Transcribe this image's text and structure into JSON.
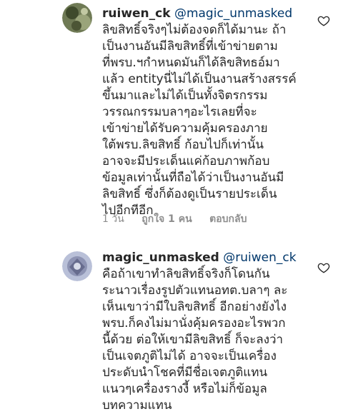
{
  "comments": [
    {
      "username": "ruiwen_ck",
      "mention": "@magic_unmasked",
      "lines": [
        "ลิขสิทธิ์จริงๆไม่ต้องจดก็ได้มานะ ถ้า",
        "เป็นงานอันมีลิขสิทธิ์ที่เข้าข่ายตาม",
        "ที่พรบ.ฯกำหนดมันก็ได้ลิขสิทธอ์มา",
        "แล้ว entityนี่ไม่ได้เป็นงานสร้างสรรค์",
        "ขึ้นมาและไม่ได้เป็นทั้งจิตรกรรม",
        "วรรณกรรมบลาๆอะไรเลยที่จะ",
        "เข้าข่ายได้รับความคุ้มครองภาย",
        "ใต้พรบ.ลิขสิทธิ์ ก้อบไปก็เท่านั้น",
        "อาจจะมีประเด็นแค่ก้อบภาพก้อบ",
        "ข้อมูลเท่านั้นที่ถือได้ว่าเป็นงานอันมี",
        "ลิขสิทธิ์ ซึ่งก็ต้องดูเป็นรายประเด็น",
        "ไปอีกทีอีก"
      ],
      "time": "1 วัน",
      "likes": "ถูกใจ 1 คน",
      "reply": "ตอบกลับ",
      "heart_icon": "heart-outline-icon"
    },
    {
      "username": "magic_unmasked",
      "mention": "@ruiwen_ck",
      "lines": [
        "คือถ้าเขาทำลิขสิทธิ์จริงก็โดนกัน",
        "ระนาวเรื่องรูปตัวแทนอทต.บลาๆ ละ",
        "เห็นเขาว่ามีใบลิขสิทธิ์ อีกอย่างยังไง",
        "พรบ.ก็คงไม่มานั่งคุ้มครองอะไรพวก",
        "นี้ด้วย ต่อให้เขามีลิขสิทธิ์ ก็จะลงว่า",
        "เป็นเจตภูติไม่ได้ อาจจะเป็นเครื่อง",
        "ประดับนำโชคที่มีชื่อเจตภูติแทน",
        "แนวๆเครื่องรางงี้ หรือไม่ก็ข้อมูล",
        "บทความแทน"
      ],
      "heart_icon": "heart-outline-icon"
    }
  ]
}
